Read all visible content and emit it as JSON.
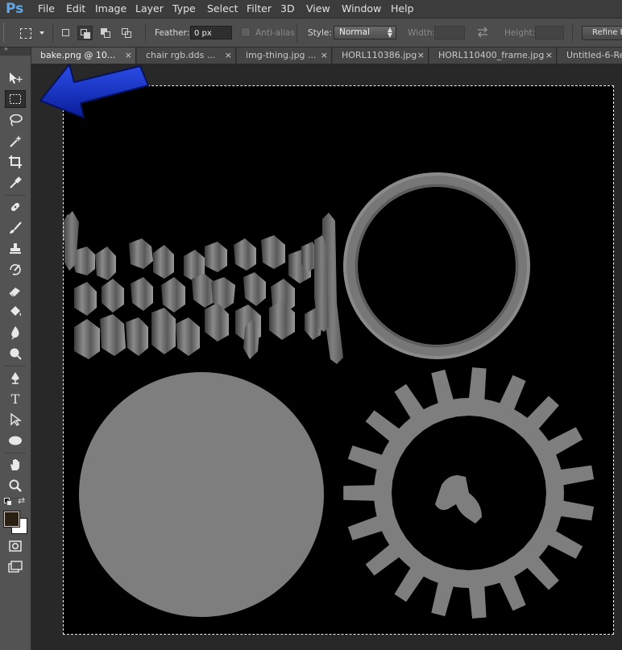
{
  "app": {
    "logo": "Ps"
  },
  "menu": {
    "items": [
      "File",
      "Edit",
      "Image",
      "Layer",
      "Type",
      "Select",
      "Filter",
      "3D",
      "View",
      "Window",
      "Help"
    ]
  },
  "options": {
    "feather_label": "Feather:",
    "feather_value": "0 px",
    "antialias_label": "Anti-alias",
    "style_label": "Style:",
    "style_value": "Normal",
    "width_label": "Width:",
    "height_label": "Height:",
    "refine_label": "Refine Edge..."
  },
  "tabs": [
    {
      "label": "bake.png @ 10...",
      "closable": "×"
    },
    {
      "label": "chair rgb.dds ...",
      "closable": "×"
    },
    {
      "label": "img-thing.jpg ...",
      "closable": "×"
    },
    {
      "label": "HORL110386.jpg",
      "closable": "×"
    },
    {
      "label": "HORL110400_frame.jpg",
      "closable": "×"
    },
    {
      "label": "Untitled-6-Re",
      "closable": ""
    }
  ],
  "tools": [
    "move-tool-icon",
    "rectangular-marquee-icon",
    "lasso-icon",
    "magic-wand-icon",
    "crop-icon",
    "eyedropper-icon",
    "spot-healing-icon",
    "brush-icon",
    "clone-stamp-icon",
    "history-brush-icon",
    "eraser-icon",
    "paint-bucket-icon",
    "blur-icon",
    "dodge-icon",
    "pen-icon",
    "type-icon",
    "path-selection-icon",
    "ellipse-shape-icon",
    "hand-icon",
    "zoom-icon"
  ],
  "colors": {
    "foreground": "#2a2012",
    "background": "#ffffff",
    "annotation_arrow": "#1431c8",
    "texture_gray": "#7e7e7e"
  }
}
